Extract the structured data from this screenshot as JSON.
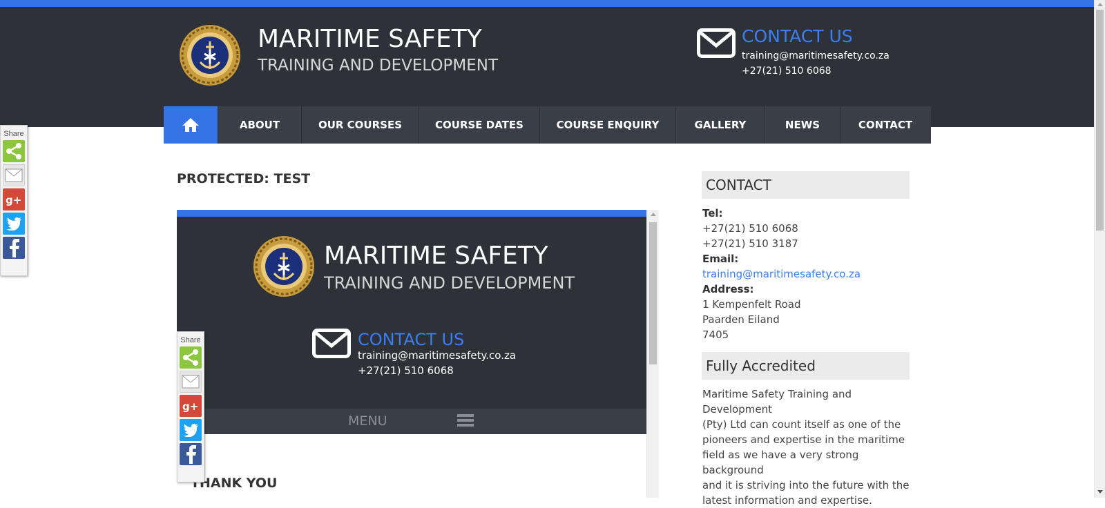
{
  "header": {
    "title": "MARITIME SAFETY",
    "subtitle": "TRAINING AND DEVELOPMENT",
    "contact_title": "CONTACT US",
    "email": "training@maritimesafety.co.za",
    "phone": "+27(21) 510 6068"
  },
  "nav": {
    "home_icon": "home-icon",
    "items": [
      {
        "label": "ABOUT"
      },
      {
        "label": "OUR COURSES"
      },
      {
        "label": "COURSE DATES"
      },
      {
        "label": "COURSE ENQUIRY"
      },
      {
        "label": "GALLERY"
      },
      {
        "label": "NEWS"
      },
      {
        "label": "CONTACT"
      }
    ]
  },
  "page": {
    "title": "PROTECTED: TEST"
  },
  "embed": {
    "title": "MARITIME SAFETY",
    "subtitle": "TRAINING AND DEVELOPMENT",
    "contact_title": "CONTACT US",
    "email": "training@maritimesafety.co.za",
    "phone": "+27(21) 510 6068",
    "menu_label": "MENU",
    "thanks": "THANK YOU"
  },
  "share": {
    "label": "Share",
    "buttons": [
      {
        "icon": "share-icon",
        "color": "#8cc63f"
      },
      {
        "icon": "email-icon",
        "color": "#dcdcdc"
      },
      {
        "icon": "google-plus-icon",
        "color": "#d34836"
      },
      {
        "icon": "twitter-icon",
        "color": "#1da1f2"
      },
      {
        "icon": "facebook-icon",
        "color": "#3b5998"
      }
    ]
  },
  "sidebar": {
    "contact_title": "CONTACT",
    "tel_label": "Tel:",
    "tel_1": "+27(21) 510 6068",
    "tel_2": "+27(21) 510 3187",
    "email_label": "Email:",
    "email": "training@maritimesafety.co.za",
    "address_label": "Address:",
    "address_1": "1 Kempenfelt Road",
    "address_2": "Paarden Eiland",
    "address_3": "7405",
    "accredited_title": "Fully Accredited",
    "accredited_text_1": "Maritime Safety Training and Development",
    "accredited_text_2": "(Pty) Ltd can count itself as one of the",
    "accredited_text_3": "pioneers and expertise in the maritime",
    "accredited_text_4": "field as we have a very strong background",
    "accredited_text_5": "and it is striving into the future with the",
    "accredited_text_6": "latest information and expertise."
  },
  "colors": {
    "accent": "#3573e6",
    "header_bg": "#2e3138",
    "nav_bg": "#3a3e46",
    "link": "#3a7ff0"
  }
}
